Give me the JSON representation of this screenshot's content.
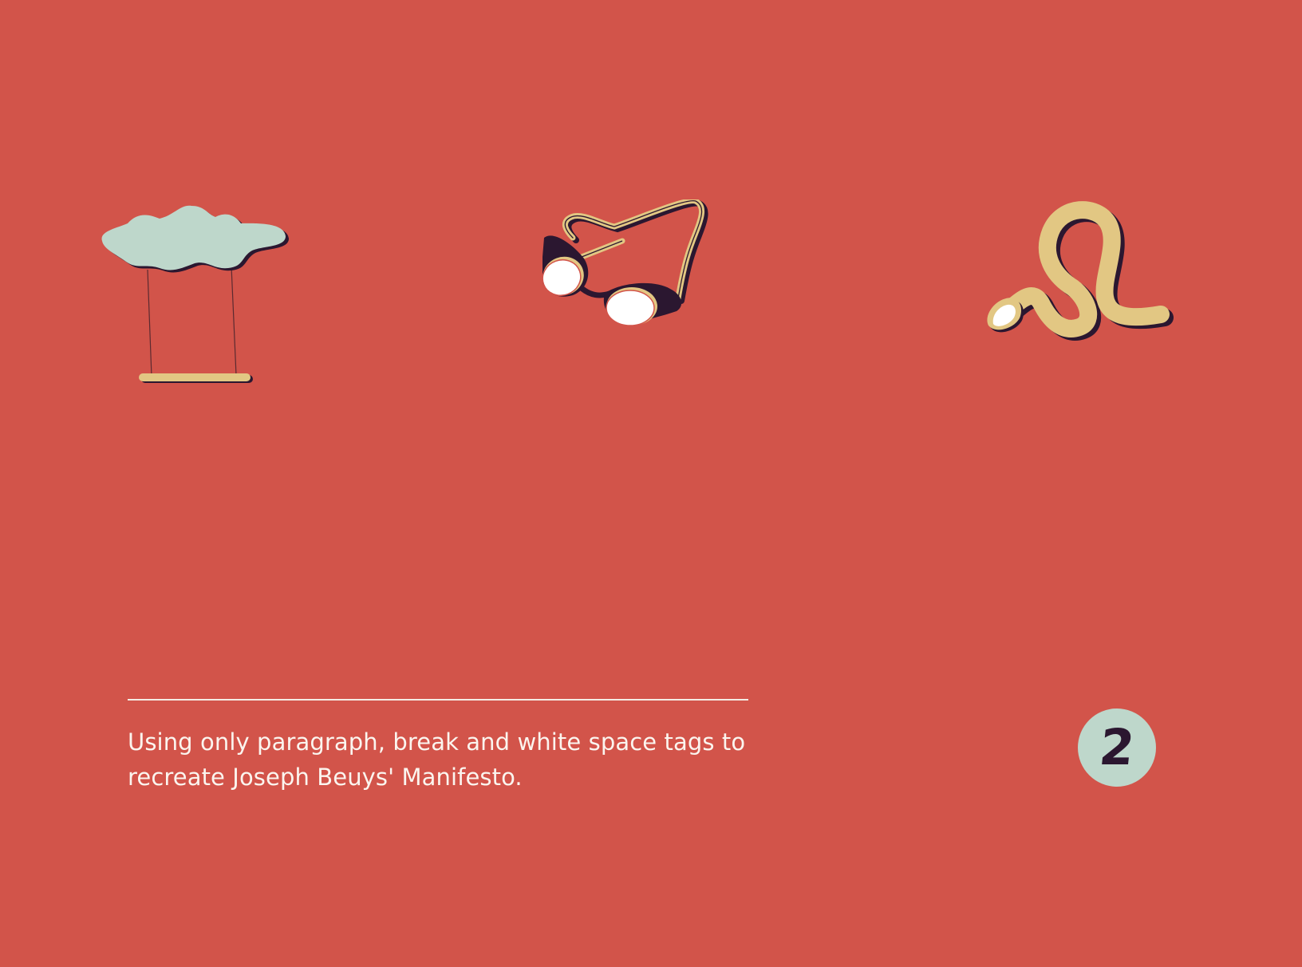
{
  "colors": {
    "background": "#d2544a",
    "mint": "#bed7cb",
    "sand": "#e2c783",
    "plum": "#2b1730",
    "text": "#fbf5ef"
  },
  "illustrations": [
    {
      "icon": "cloud-swing-icon"
    },
    {
      "icon": "goggles-icon"
    },
    {
      "icon": "snake-icon"
    }
  ],
  "caption": {
    "line1": "Using only paragraph, break and white space tags to",
    "line2": "recreate Joseph Beuys' Manifesto."
  },
  "page_badge": {
    "number": "2"
  }
}
